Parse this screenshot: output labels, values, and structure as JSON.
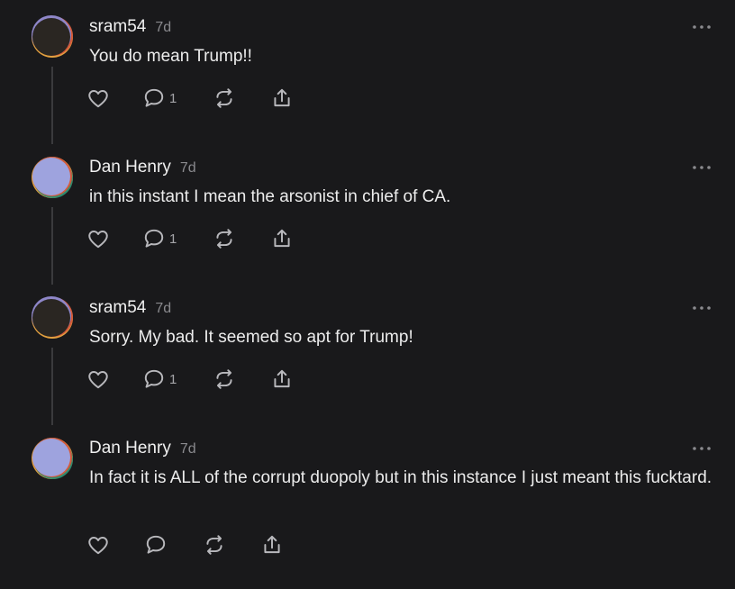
{
  "colors": {
    "background": "#19191b",
    "text": "#ececec",
    "muted": "#8a8a8e",
    "icon": "#b8b8bc",
    "thread_line": "#3a3a3d"
  },
  "comments": [
    {
      "username": "sram54",
      "time": "7d",
      "text": "You do mean Trump!!",
      "reply_count": "1",
      "avatar": "dark-avatar",
      "icons": [
        "heart-icon",
        "comment-icon",
        "repost-icon",
        "share-icon"
      ]
    },
    {
      "username": "Dan Henry",
      "time": "7d",
      "text": "in this instant I mean the arsonist in chief of CA.",
      "reply_count": "1",
      "avatar": "lavender-avatar",
      "icons": [
        "heart-icon",
        "comment-icon",
        "repost-icon",
        "share-icon"
      ]
    },
    {
      "username": "sram54",
      "time": "7d",
      "text": "Sorry. My bad. It seemed so apt for Trump!",
      "reply_count": "1",
      "avatar": "dark-avatar",
      "icons": [
        "heart-icon",
        "comment-icon",
        "repost-icon",
        "share-icon"
      ]
    },
    {
      "username": "Dan Henry",
      "time": "7d",
      "text": "In fact it is ALL of the corrupt duopoly but in this instance I just meant this fucktard.",
      "reply_count": "",
      "avatar": "lavender-avatar",
      "icons": [
        "heart-icon",
        "comment-icon",
        "repost-icon",
        "share-icon"
      ]
    }
  ]
}
